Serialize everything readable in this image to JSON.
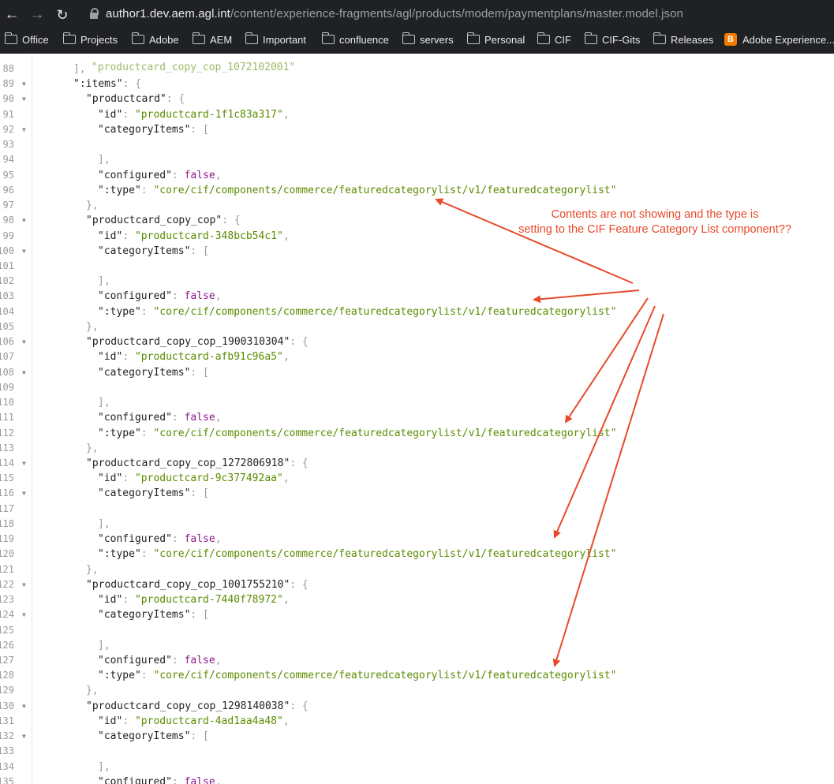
{
  "browser": {
    "nav": {
      "back": "←",
      "forward": "→",
      "reload": "↻"
    },
    "url_host": "author1.dev.aem.agl.int",
    "url_path": "/content/experience-fragments/agl/products/modem/paymentplans/master.model.json",
    "bookmarks": [
      {
        "label": "Office"
      },
      {
        "label": "Projects"
      },
      {
        "label": "Adobe"
      },
      {
        "label": "AEM"
      },
      {
        "label": "Important"
      },
      {
        "label": "confluence"
      },
      {
        "label": "servers"
      },
      {
        "label": "Personal"
      },
      {
        "label": "CIF"
      },
      {
        "label": "CIF-Gits"
      },
      {
        "label": "Releases"
      },
      {
        "label": "Adobe Experience..."
      }
    ]
  },
  "colors": {
    "annotation": "#e84a2a",
    "string": "#5b8c00",
    "boolean": "#8b1a8b"
  },
  "code": {
    "partial_top": "\"productcard_copy_cop_1072102001\"",
    "lines": [
      {
        "n": "88",
        "fold": false,
        "indent": 0,
        "t": [
          {
            "c": "p",
            "v": "],"
          }
        ]
      },
      {
        "n": "89",
        "fold": true,
        "indent": 0,
        "t": [
          {
            "c": "k",
            "v": "\":items\""
          },
          {
            "c": "p",
            "v": ": {"
          }
        ]
      },
      {
        "n": "90",
        "fold": true,
        "indent": 1,
        "t": [
          {
            "c": "k",
            "v": "\"productcard\""
          },
          {
            "c": "p",
            "v": ": {"
          }
        ]
      },
      {
        "n": "91",
        "fold": false,
        "indent": 2,
        "t": [
          {
            "c": "k",
            "v": "\"id\""
          },
          {
            "c": "p",
            "v": ": "
          },
          {
            "c": "s",
            "v": "\"productcard-1f1c83a317\""
          },
          {
            "c": "p",
            "v": ","
          }
        ]
      },
      {
        "n": "92",
        "fold": true,
        "indent": 2,
        "t": [
          {
            "c": "k",
            "v": "\"categoryItems\""
          },
          {
            "c": "p",
            "v": ": ["
          }
        ]
      },
      {
        "n": "93",
        "fold": false,
        "indent": 2,
        "t": []
      },
      {
        "n": "94",
        "fold": false,
        "indent": 2,
        "t": [
          {
            "c": "p",
            "v": "],"
          }
        ]
      },
      {
        "n": "95",
        "fold": false,
        "indent": 2,
        "t": [
          {
            "c": "k",
            "v": "\"configured\""
          },
          {
            "c": "p",
            "v": ": "
          },
          {
            "c": "b",
            "v": "false"
          },
          {
            "c": "p",
            "v": ","
          }
        ]
      },
      {
        "n": "96",
        "fold": false,
        "indent": 2,
        "t": [
          {
            "c": "k",
            "v": "\":type\""
          },
          {
            "c": "p",
            "v": ": "
          },
          {
            "c": "s",
            "v": "\"core/cif/components/commerce/featuredcategorylist/v1/featuredcategorylist\""
          }
        ]
      },
      {
        "n": "97",
        "fold": false,
        "indent": 1,
        "t": [
          {
            "c": "p",
            "v": "},"
          }
        ]
      },
      {
        "n": "98",
        "fold": true,
        "indent": 1,
        "t": [
          {
            "c": "k",
            "v": "\"productcard_copy_cop\""
          },
          {
            "c": "p",
            "v": ": {"
          }
        ]
      },
      {
        "n": "99",
        "fold": false,
        "indent": 2,
        "t": [
          {
            "c": "k",
            "v": "\"id\""
          },
          {
            "c": "p",
            "v": ": "
          },
          {
            "c": "s",
            "v": "\"productcard-348bcb54c1\""
          },
          {
            "c": "p",
            "v": ","
          }
        ]
      },
      {
        "n": "100",
        "fold": true,
        "indent": 2,
        "t": [
          {
            "c": "k",
            "v": "\"categoryItems\""
          },
          {
            "c": "p",
            "v": ": ["
          }
        ]
      },
      {
        "n": "101",
        "fold": false,
        "indent": 2,
        "t": []
      },
      {
        "n": "102",
        "fold": false,
        "indent": 2,
        "t": [
          {
            "c": "p",
            "v": "],"
          }
        ]
      },
      {
        "n": "103",
        "fold": false,
        "indent": 2,
        "t": [
          {
            "c": "k",
            "v": "\"configured\""
          },
          {
            "c": "p",
            "v": ": "
          },
          {
            "c": "b",
            "v": "false"
          },
          {
            "c": "p",
            "v": ","
          }
        ]
      },
      {
        "n": "104",
        "fold": false,
        "indent": 2,
        "t": [
          {
            "c": "k",
            "v": "\":type\""
          },
          {
            "c": "p",
            "v": ": "
          },
          {
            "c": "s",
            "v": "\"core/cif/components/commerce/featuredcategorylist/v1/featuredcategorylist\""
          }
        ]
      },
      {
        "n": "105",
        "fold": false,
        "indent": 1,
        "t": [
          {
            "c": "p",
            "v": "},"
          }
        ]
      },
      {
        "n": "106",
        "fold": true,
        "indent": 1,
        "t": [
          {
            "c": "k",
            "v": "\"productcard_copy_cop_1900310304\""
          },
          {
            "c": "p",
            "v": ": {"
          }
        ]
      },
      {
        "n": "107",
        "fold": false,
        "indent": 2,
        "t": [
          {
            "c": "k",
            "v": "\"id\""
          },
          {
            "c": "p",
            "v": ": "
          },
          {
            "c": "s",
            "v": "\"productcard-afb91c96a5\""
          },
          {
            "c": "p",
            "v": ","
          }
        ]
      },
      {
        "n": "108",
        "fold": true,
        "indent": 2,
        "t": [
          {
            "c": "k",
            "v": "\"categoryItems\""
          },
          {
            "c": "p",
            "v": ": ["
          }
        ]
      },
      {
        "n": "109",
        "fold": false,
        "indent": 2,
        "t": []
      },
      {
        "n": "110",
        "fold": false,
        "indent": 2,
        "t": [
          {
            "c": "p",
            "v": "],"
          }
        ]
      },
      {
        "n": "111",
        "fold": false,
        "indent": 2,
        "t": [
          {
            "c": "k",
            "v": "\"configured\""
          },
          {
            "c": "p",
            "v": ": "
          },
          {
            "c": "b",
            "v": "false"
          },
          {
            "c": "p",
            "v": ","
          }
        ]
      },
      {
        "n": "112",
        "fold": false,
        "indent": 2,
        "t": [
          {
            "c": "k",
            "v": "\":type\""
          },
          {
            "c": "p",
            "v": ": "
          },
          {
            "c": "s",
            "v": "\"core/cif/components/commerce/featuredcategorylist/v1/featuredcategorylist\""
          }
        ]
      },
      {
        "n": "113",
        "fold": false,
        "indent": 1,
        "t": [
          {
            "c": "p",
            "v": "},"
          }
        ]
      },
      {
        "n": "114",
        "fold": true,
        "indent": 1,
        "t": [
          {
            "c": "k",
            "v": "\"productcard_copy_cop_1272806918\""
          },
          {
            "c": "p",
            "v": ": {"
          }
        ]
      },
      {
        "n": "115",
        "fold": false,
        "indent": 2,
        "t": [
          {
            "c": "k",
            "v": "\"id\""
          },
          {
            "c": "p",
            "v": ": "
          },
          {
            "c": "s",
            "v": "\"productcard-9c377492aa\""
          },
          {
            "c": "p",
            "v": ","
          }
        ]
      },
      {
        "n": "116",
        "fold": true,
        "indent": 2,
        "t": [
          {
            "c": "k",
            "v": "\"categoryItems\""
          },
          {
            "c": "p",
            "v": ": ["
          }
        ]
      },
      {
        "n": "117",
        "fold": false,
        "indent": 2,
        "t": []
      },
      {
        "n": "118",
        "fold": false,
        "indent": 2,
        "t": [
          {
            "c": "p",
            "v": "],"
          }
        ]
      },
      {
        "n": "119",
        "fold": false,
        "indent": 2,
        "t": [
          {
            "c": "k",
            "v": "\"configured\""
          },
          {
            "c": "p",
            "v": ": "
          },
          {
            "c": "b",
            "v": "false"
          },
          {
            "c": "p",
            "v": ","
          }
        ]
      },
      {
        "n": "120",
        "fold": false,
        "indent": 2,
        "t": [
          {
            "c": "k",
            "v": "\":type\""
          },
          {
            "c": "p",
            "v": ": "
          },
          {
            "c": "s",
            "v": "\"core/cif/components/commerce/featuredcategorylist/v1/featuredcategorylist\""
          }
        ]
      },
      {
        "n": "121",
        "fold": false,
        "indent": 1,
        "t": [
          {
            "c": "p",
            "v": "},"
          }
        ]
      },
      {
        "n": "122",
        "fold": true,
        "indent": 1,
        "t": [
          {
            "c": "k",
            "v": "\"productcard_copy_cop_1001755210\""
          },
          {
            "c": "p",
            "v": ": {"
          }
        ]
      },
      {
        "n": "123",
        "fold": false,
        "indent": 2,
        "t": [
          {
            "c": "k",
            "v": "\"id\""
          },
          {
            "c": "p",
            "v": ": "
          },
          {
            "c": "s",
            "v": "\"productcard-7440f78972\""
          },
          {
            "c": "p",
            "v": ","
          }
        ]
      },
      {
        "n": "124",
        "fold": true,
        "indent": 2,
        "t": [
          {
            "c": "k",
            "v": "\"categoryItems\""
          },
          {
            "c": "p",
            "v": ": ["
          }
        ]
      },
      {
        "n": "125",
        "fold": false,
        "indent": 2,
        "t": []
      },
      {
        "n": "126",
        "fold": false,
        "indent": 2,
        "t": [
          {
            "c": "p",
            "v": "],"
          }
        ]
      },
      {
        "n": "127",
        "fold": false,
        "indent": 2,
        "t": [
          {
            "c": "k",
            "v": "\"configured\""
          },
          {
            "c": "p",
            "v": ": "
          },
          {
            "c": "b",
            "v": "false"
          },
          {
            "c": "p",
            "v": ","
          }
        ]
      },
      {
        "n": "128",
        "fold": false,
        "indent": 2,
        "t": [
          {
            "c": "k",
            "v": "\":type\""
          },
          {
            "c": "p",
            "v": ": "
          },
          {
            "c": "s",
            "v": "\"core/cif/components/commerce/featuredcategorylist/v1/featuredcategorylist\""
          }
        ]
      },
      {
        "n": "129",
        "fold": false,
        "indent": 1,
        "t": [
          {
            "c": "p",
            "v": "},"
          }
        ]
      },
      {
        "n": "130",
        "fold": true,
        "indent": 1,
        "t": [
          {
            "c": "k",
            "v": "\"productcard_copy_cop_1298140038\""
          },
          {
            "c": "p",
            "v": ": {"
          }
        ]
      },
      {
        "n": "131",
        "fold": false,
        "indent": 2,
        "t": [
          {
            "c": "k",
            "v": "\"id\""
          },
          {
            "c": "p",
            "v": ": "
          },
          {
            "c": "s",
            "v": "\"productcard-4ad1aa4a48\""
          },
          {
            "c": "p",
            "v": ","
          }
        ]
      },
      {
        "n": "132",
        "fold": true,
        "indent": 2,
        "t": [
          {
            "c": "k",
            "v": "\"categoryItems\""
          },
          {
            "c": "p",
            "v": ": ["
          }
        ]
      },
      {
        "n": "133",
        "fold": false,
        "indent": 2,
        "t": []
      },
      {
        "n": "134",
        "fold": false,
        "indent": 2,
        "t": [
          {
            "c": "p",
            "v": "],"
          }
        ]
      },
      {
        "n": "135",
        "fold": false,
        "indent": 2,
        "t": [
          {
            "c": "k",
            "v": "\"configured\""
          },
          {
            "c": "p",
            "v": ": "
          },
          {
            "c": "b",
            "v": "false"
          },
          {
            "c": "p",
            "v": ","
          }
        ]
      }
    ]
  },
  "annotation": {
    "line1": "Contents are not showing and the type is",
    "line2": "setting to the CIF Feature Category List component??"
  }
}
